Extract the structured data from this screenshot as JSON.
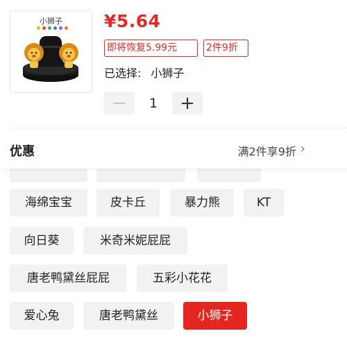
{
  "product": {
    "thumbnail_caption": "小狮子",
    "price": "¥5.64",
    "tags": [
      "即将恢复5.99元",
      "2件9折"
    ],
    "selected_label": "已选择:",
    "selected_value": "小狮子"
  },
  "quantity": {
    "minus": "−",
    "value": "1",
    "plus": "+"
  },
  "promo": {
    "title": "优惠",
    "description": "满2件享9折"
  },
  "variants": {
    "partially_hidden": [
      "",
      "",
      ""
    ],
    "items": [
      "海绵宝宝",
      "皮卡丘",
      "暴力熊",
      "KT",
      "向日葵",
      "米奇米妮屁屁",
      "唐老鸭黛丝屁屁",
      "五彩小花花",
      "爱心兔",
      "唐老鸭黛丝",
      "小狮子"
    ],
    "selected": "小狮子"
  },
  "colors": {
    "accent": "#e12a2a",
    "chip_bg": "#f2f2f2",
    "chip_active_bg": "#e3261f"
  }
}
